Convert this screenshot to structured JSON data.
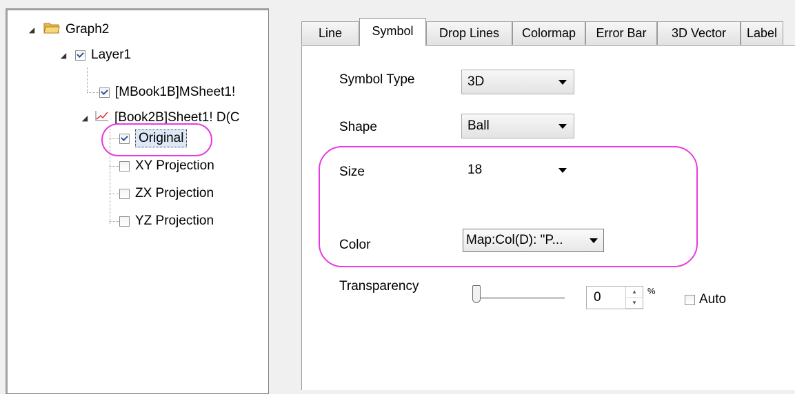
{
  "tree": {
    "graph": "Graph2",
    "layer": "Layer1",
    "plot1": "[MBook1B]MSheet1!",
    "plot2": "[Book2B]Sheet1! D(C",
    "original": "Original",
    "xy": "XY Projection",
    "zx": "ZX Projection",
    "yz": "YZ Projection"
  },
  "tabs": [
    "Line",
    "Symbol",
    "Drop Lines",
    "Colormap",
    "Error Bar",
    "3D Vector",
    "Label"
  ],
  "active_tab": "Symbol",
  "symbol": {
    "type_label": "Symbol Type",
    "type_value": "3D",
    "shape_label": "Shape",
    "shape_value": "Ball",
    "size_label": "Size",
    "size_value": "18",
    "color_label": "Color",
    "color_value": "Map:Col(D): \"P...",
    "transparency_label": "Transparency",
    "transparency_value": "0",
    "transparency_level": 0,
    "percent": "%",
    "auto_label": "Auto"
  },
  "colors": {
    "highlight": "#e83ae0",
    "check": "#2b4fa0"
  },
  "icons": [
    "folder-icon",
    "line-plot-icon",
    "dropdown-arrow-icon",
    "spin-up-icon",
    "spin-down-icon"
  ]
}
